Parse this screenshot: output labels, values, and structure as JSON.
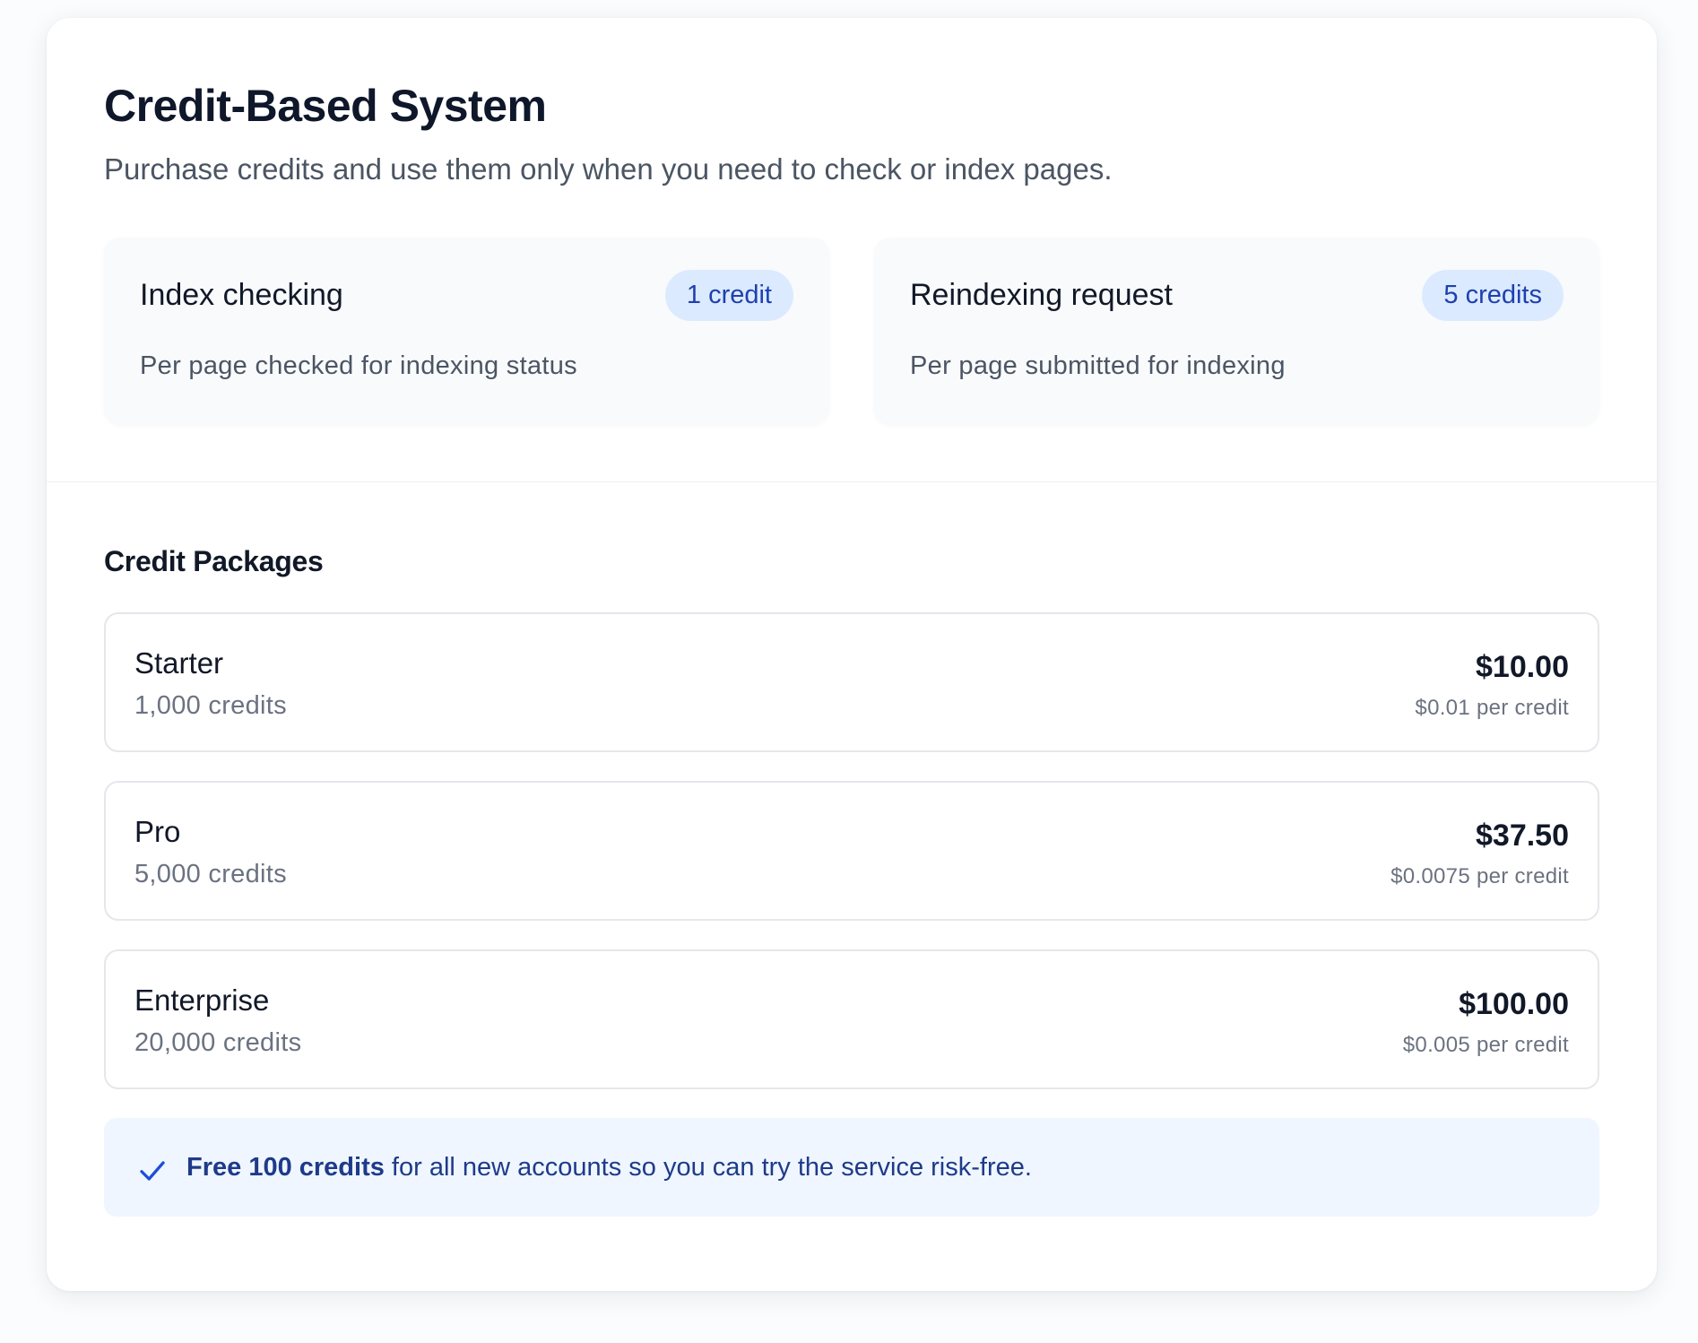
{
  "header": {
    "title": "Credit-Based System",
    "subtitle": "Purchase credits and use them only when you need to check or index pages."
  },
  "costs": [
    {
      "name": "Index checking",
      "badge": "1 credit",
      "description": "Per page checked for indexing status"
    },
    {
      "name": "Reindexing request",
      "badge": "5 credits",
      "description": "Per page submitted for indexing"
    }
  ],
  "packages_section": {
    "title": "Credit Packages",
    "items": [
      {
        "name": "Starter",
        "credits": "1,000 credits",
        "price": "$10.00",
        "per_credit": "$0.01 per credit"
      },
      {
        "name": "Pro",
        "credits": "5,000 credits",
        "price": "$37.50",
        "per_credit": "$0.0075 per credit"
      },
      {
        "name": "Enterprise",
        "credits": "20,000 credits",
        "price": "$100.00",
        "per_credit": "$0.005 per credit"
      }
    ]
  },
  "note": {
    "icon": "check-icon",
    "highlight": "Free 100 credits",
    "text": " for all new accounts so you can try the service risk-free."
  },
  "colors": {
    "accent": "#1e40af",
    "badge_bg": "#dbeafe",
    "note_bg": "#eff6ff"
  }
}
